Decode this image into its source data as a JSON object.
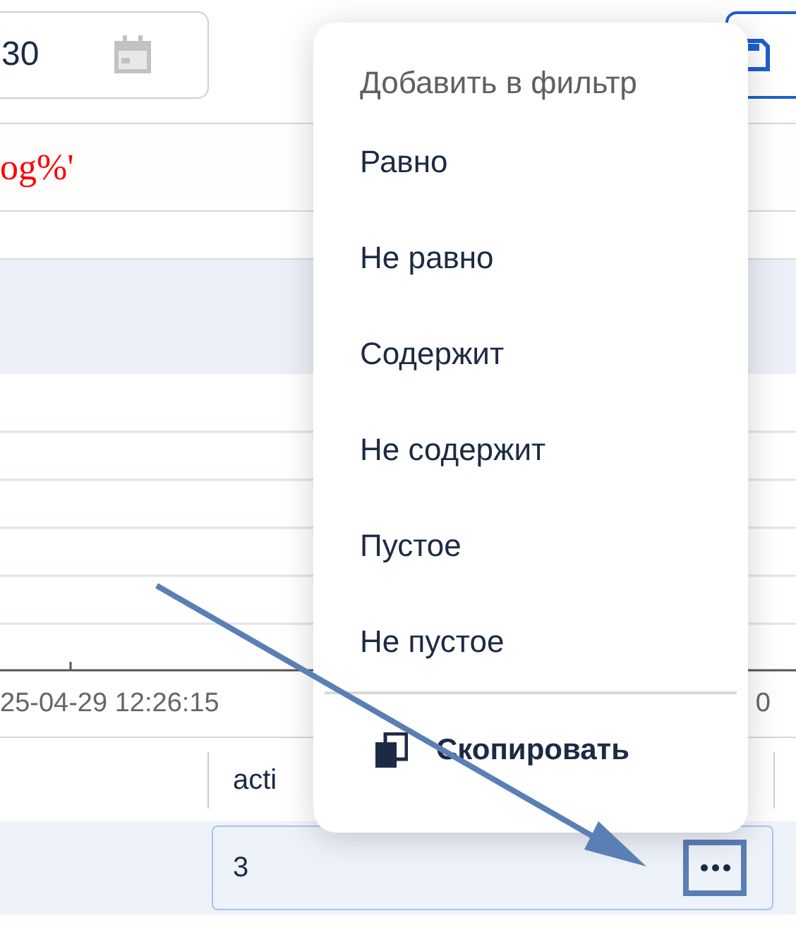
{
  "date_field": {
    "value": "30"
  },
  "query": {
    "text": "og%'"
  },
  "chart": {
    "x_labels": [
      "25-04-29 12:26:15",
      "0"
    ]
  },
  "table": {
    "columns": [
      {
        "label": "acti"
      }
    ],
    "rows": [
      {
        "selected": true,
        "cell": "3"
      }
    ]
  },
  "context_menu": {
    "title": "Добавить в фильтр",
    "items": [
      {
        "label": "Равно"
      },
      {
        "label": "Не равно"
      },
      {
        "label": "Содержит"
      },
      {
        "label": "Не содержит"
      },
      {
        "label": "Пустое"
      },
      {
        "label": "Не пустое"
      }
    ],
    "copy_action": {
      "label": "Скопировать"
    }
  }
}
